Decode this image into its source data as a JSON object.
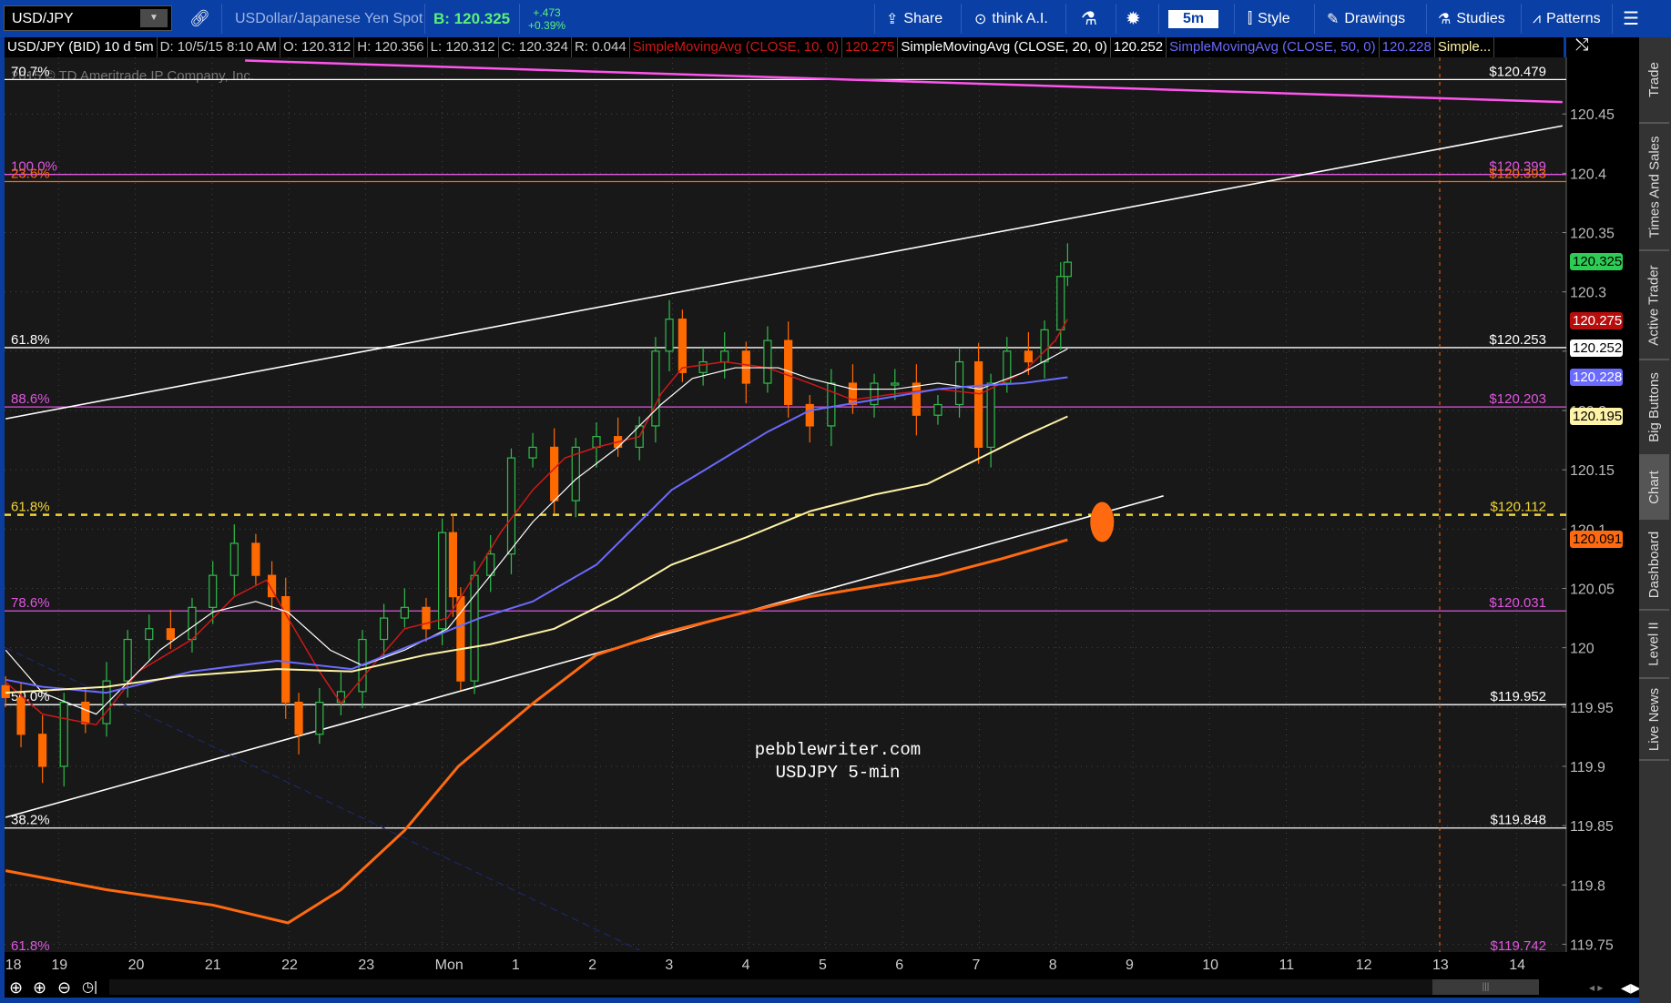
{
  "toolbar": {
    "symbol": "USD/JPY",
    "description": "USDollar/Japanese Yen Spot",
    "bid": "B: 120.325",
    "change_abs": "+.473",
    "change_pct": "+0.39%",
    "share": "Share",
    "think_ai": "think A.I.",
    "timeframe": "5m",
    "style": "Style",
    "drawings": "Drawings",
    "studies": "Studies",
    "patterns": "Patterns"
  },
  "infobar": {
    "title": "USD/JPY (BID) 10 d 5m",
    "date": "D: 10/5/15 8:10 AM",
    "open": "O: 120.312",
    "high": "H: 120.356",
    "low": "L: 120.312",
    "close": "C: 120.324",
    "range": "R: 0.044",
    "sma10_label": "SimpleMovingAvg (CLOSE, 10, 0)",
    "sma10_value": "120.275",
    "sma20_label": "SimpleMovingAvg (CLOSE, 20, 0)",
    "sma20_value": "120.252",
    "sma50_label": "SimpleMovingAvg (CLOSE, 50, 0)",
    "sma50_value": "120.228",
    "more_label": "Simple..."
  },
  "copyright": "2015 © TD Ameritrade IP Company, Inc.",
  "watermark": [
    "pebblewriter.com",
    "USDJPY 5-min"
  ],
  "side_tabs": [
    {
      "label": "Trade",
      "active": false
    },
    {
      "label": "Times And Sales",
      "active": false
    },
    {
      "label": "Active Trader",
      "active": false
    },
    {
      "label": "Big Buttons",
      "active": false
    },
    {
      "label": "Chart",
      "active": true
    },
    {
      "label": "Dashboard",
      "active": false
    },
    {
      "label": "Level II",
      "active": false
    },
    {
      "label": "Live News",
      "active": false
    }
  ],
  "chart_data": {
    "type": "candlestick",
    "title": "USD/JPY (BID) 10 d 5m",
    "ylim": [
      119.738,
      120.51
    ],
    "xlim": [
      -1.75,
      18.5
    ],
    "yticks": [
      "120.45",
      "120.4",
      "120.35",
      "120.3",
      "120.25",
      "120.2",
      "120.15",
      "120.1",
      "120.05",
      "120",
      "119.95",
      "119.9",
      "119.85",
      "119.8",
      "119.75"
    ],
    "xticks": [
      {
        "t": -1.6,
        "label": "18"
      },
      {
        "t": -1.0,
        "label": "19"
      },
      {
        "t": 0,
        "label": "20"
      },
      {
        "t": 1,
        "label": "21"
      },
      {
        "t": 2,
        "label": "22"
      },
      {
        "t": 3,
        "label": "23"
      },
      {
        "t": 4,
        "label": "Mon"
      },
      {
        "t": 5,
        "label": "1"
      },
      {
        "t": 6,
        "label": "2"
      },
      {
        "t": 7,
        "label": "3"
      },
      {
        "t": 8,
        "label": "4"
      },
      {
        "t": 9,
        "label": "5"
      },
      {
        "t": 10,
        "label": "6"
      },
      {
        "t": 11,
        "label": "7"
      },
      {
        "t": 12,
        "label": "8"
      },
      {
        "t": 13,
        "label": "9"
      },
      {
        "t": 14,
        "label": "10"
      },
      {
        "t": 15,
        "label": "11"
      },
      {
        "t": 16,
        "label": "12"
      },
      {
        "t": 17,
        "label": "13"
      },
      {
        "t": 18,
        "label": "14"
      }
    ],
    "colors": {
      "up": "#2fbd4a",
      "down": "#ff6a00"
    },
    "closes": [
      [
        -1.69,
        119.958
      ],
      [
        -1.49,
        119.927
      ],
      [
        -1.21,
        119.9
      ],
      [
        -0.93,
        119.954
      ],
      [
        -0.65,
        119.936
      ],
      [
        -0.375,
        119.972
      ],
      [
        -0.1,
        120.007
      ],
      [
        0.18,
        120.016
      ],
      [
        0.46,
        120.007
      ],
      [
        0.74,
        120.034
      ],
      [
        1.01,
        120.061
      ],
      [
        1.29,
        120.088
      ],
      [
        1.57,
        120.061
      ],
      [
        1.78,
        120.043
      ],
      [
        1.96,
        119.954
      ],
      [
        2.13,
        119.927
      ],
      [
        2.4,
        119.954
      ],
      [
        2.68,
        119.963
      ],
      [
        2.96,
        120.007
      ],
      [
        3.24,
        120.025
      ],
      [
        3.51,
        120.034
      ],
      [
        3.79,
        120.016
      ],
      [
        4.0,
        120.097
      ],
      [
        4.14,
        120.043
      ],
      [
        4.24,
        119.972
      ],
      [
        4.42,
        120.061
      ],
      [
        4.63,
        120.079
      ],
      [
        4.9,
        120.16
      ],
      [
        5.18,
        120.169
      ],
      [
        5.46,
        120.124
      ],
      [
        5.74,
        120.169
      ],
      [
        6.01,
        120.178
      ],
      [
        6.29,
        120.169
      ],
      [
        6.57,
        120.187
      ],
      [
        6.78,
        120.25
      ],
      [
        6.96,
        120.277
      ],
      [
        7.13,
        120.232
      ],
      [
        7.4,
        120.241
      ],
      [
        7.68,
        120.25
      ],
      [
        7.96,
        120.223
      ],
      [
        8.24,
        120.259
      ],
      [
        8.51,
        120.205
      ],
      [
        8.79,
        120.187
      ],
      [
        9.07,
        120.223
      ],
      [
        9.35,
        120.205
      ],
      [
        9.63,
        120.223
      ],
      [
        9.9,
        120.223
      ],
      [
        10.18,
        120.196
      ],
      [
        10.46,
        120.205
      ],
      [
        10.74,
        120.241
      ],
      [
        10.99,
        120.169
      ],
      [
        11.15,
        120.223
      ],
      [
        11.36,
        120.25
      ],
      [
        11.64,
        120.241
      ],
      [
        11.85,
        120.268
      ],
      [
        12.06,
        120.313
      ],
      [
        12.15,
        120.325
      ]
    ],
    "series": [
      {
        "name": "SMA 10",
        "color": "#d01818",
        "width": 1.5,
        "points": [
          [
            -1.69,
            119.971
          ],
          [
            -1.21,
            119.944
          ],
          [
            -0.51,
            119.935
          ],
          [
            0.04,
            119.98
          ],
          [
            0.74,
            120.007
          ],
          [
            1.29,
            120.043
          ],
          [
            1.71,
            120.057
          ],
          [
            1.99,
            120.025
          ],
          [
            2.4,
            119.98
          ],
          [
            2.68,
            119.953
          ],
          [
            3.03,
            119.98
          ],
          [
            3.51,
            120.016
          ],
          [
            4.07,
            120.025
          ],
          [
            4.42,
            120.061
          ],
          [
            4.76,
            120.097
          ],
          [
            5.18,
            120.133
          ],
          [
            5.6,
            120.16
          ],
          [
            6.01,
            120.169
          ],
          [
            6.57,
            120.178
          ],
          [
            6.85,
            120.214
          ],
          [
            7.13,
            120.236
          ],
          [
            7.68,
            120.241
          ],
          [
            8.24,
            120.236
          ],
          [
            8.79,
            120.223
          ],
          [
            9.35,
            120.209
          ],
          [
            9.9,
            120.214
          ],
          [
            10.46,
            120.218
          ],
          [
            11.01,
            120.214
          ],
          [
            11.57,
            120.232
          ],
          [
            11.99,
            120.259
          ],
          [
            12.15,
            120.277
          ]
        ]
      },
      {
        "name": "SMA 20",
        "color": "#ffffff",
        "width": 1.2,
        "points": [
          [
            -1.69,
            119.998
          ],
          [
            -1.21,
            119.962
          ],
          [
            -0.51,
            119.944
          ],
          [
            0.32,
            119.998
          ],
          [
            1.01,
            120.03
          ],
          [
            1.57,
            120.039
          ],
          [
            1.99,
            120.03
          ],
          [
            2.54,
            119.998
          ],
          [
            2.96,
            119.985
          ],
          [
            3.51,
            119.998
          ],
          [
            4.07,
            120.016
          ],
          [
            4.63,
            120.061
          ],
          [
            5.18,
            120.106
          ],
          [
            5.74,
            120.142
          ],
          [
            6.29,
            120.169
          ],
          [
            6.85,
            120.205
          ],
          [
            7.26,
            120.227
          ],
          [
            7.82,
            120.236
          ],
          [
            8.38,
            120.236
          ],
          [
            8.79,
            120.227
          ],
          [
            9.35,
            120.218
          ],
          [
            9.9,
            120.218
          ],
          [
            10.46,
            120.223
          ],
          [
            11.01,
            120.218
          ],
          [
            11.57,
            120.232
          ],
          [
            12.15,
            120.252
          ]
        ]
      },
      {
        "name": "SMA 50",
        "color": "#6a6aff",
        "width": 2,
        "points": [
          [
            -1.69,
            119.973
          ],
          [
            -1.21,
            119.967
          ],
          [
            -0.38,
            119.962
          ],
          [
            0.74,
            119.98
          ],
          [
            1.85,
            119.989
          ],
          [
            2.82,
            119.982
          ],
          [
            3.79,
            120.007
          ],
          [
            4.49,
            120.025
          ],
          [
            5.18,
            120.039
          ],
          [
            6.01,
            120.07
          ],
          [
            6.57,
            120.106
          ],
          [
            6.99,
            120.133
          ],
          [
            7.68,
            120.16
          ],
          [
            8.24,
            120.182
          ],
          [
            8.79,
            120.2
          ],
          [
            9.63,
            120.209
          ],
          [
            10.46,
            120.218
          ],
          [
            11.01,
            120.221
          ],
          [
            11.57,
            120.223
          ],
          [
            12.15,
            120.228
          ]
        ]
      },
      {
        "name": "SMA yellow",
        "color": "#fff3a8",
        "width": 2,
        "points": [
          [
            -1.69,
            119.962
          ],
          [
            -0.38,
            119.967
          ],
          [
            0.6,
            119.976
          ],
          [
            1.85,
            119.982
          ],
          [
            2.82,
            119.98
          ],
          [
            3.79,
            119.994
          ],
          [
            4.63,
            120.003
          ],
          [
            5.46,
            120.016
          ],
          [
            6.29,
            120.043
          ],
          [
            6.99,
            120.07
          ],
          [
            7.96,
            120.093
          ],
          [
            8.79,
            120.115
          ],
          [
            9.63,
            120.129
          ],
          [
            10.32,
            120.138
          ],
          [
            11.01,
            120.16
          ],
          [
            11.57,
            120.178
          ],
          [
            12.15,
            120.195
          ]
        ]
      },
      {
        "name": "SMA orange",
        "color": "#ff6a10",
        "width": 3,
        "points": [
          [
            -1.69,
            119.812
          ],
          [
            -0.38,
            119.796
          ],
          [
            1.01,
            119.783
          ],
          [
            1.99,
            119.768
          ],
          [
            2.68,
            119.796
          ],
          [
            3.51,
            119.846
          ],
          [
            4.21,
            119.9
          ],
          [
            5.18,
            119.953
          ],
          [
            6.01,
            119.994
          ],
          [
            6.85,
            120.012
          ],
          [
            7.96,
            120.03
          ],
          [
            8.79,
            120.043
          ],
          [
            9.63,
            120.052
          ],
          [
            10.46,
            120.061
          ],
          [
            11.29,
            120.075
          ],
          [
            12.15,
            120.091
          ]
        ]
      }
    ],
    "trendlines": [
      {
        "name": "magenta-trendline",
        "color": "#ff55ee",
        "width": 2.5,
        "from": [
          1.43,
          120.495
        ],
        "to": [
          18.6,
          120.46
        ]
      },
      {
        "name": "upper-channel-line",
        "color": "#ffffff",
        "width": 1.6,
        "from": [
          -1.69,
          120.193
        ],
        "to": [
          18.6,
          120.44
        ]
      },
      {
        "name": "lower-channel-line",
        "color": "#ffffff",
        "width": 1.6,
        "from": [
          -1.69,
          119.857
        ],
        "to": [
          13.4,
          120.128
        ]
      },
      {
        "name": "navy-dashed-line",
        "color": "#1c2a7a",
        "width": 1,
        "dash": true,
        "from": [
          -1.69,
          120.0
        ],
        "to": [
          6.57,
          119.745
        ]
      }
    ],
    "fib_levels": [
      {
        "pct": "70.7%",
        "price": 120.479,
        "label": "$120.479",
        "color": "#ffffff",
        "line": true
      },
      {
        "pct": "100.0%",
        "price": 120.399,
        "label": "$120.399",
        "color": "#e055e0",
        "line": true
      },
      {
        "pct": "23.6%",
        "price": 120.393,
        "label": "$120.393",
        "color": "#ff6a10",
        "line": true
      },
      {
        "pct": "61.8%",
        "price": 120.253,
        "label": "$120.253",
        "color": "#ffffff",
        "line": true
      },
      {
        "pct": "88.6%",
        "price": 120.203,
        "label": "$120.203",
        "color": "#e055e0",
        "line": true
      },
      {
        "pct": "61.8%",
        "price": 120.112,
        "label": "$120.112",
        "color": "#f2d633",
        "line": true,
        "dashed": true
      },
      {
        "pct": "78.6%",
        "price": 120.031,
        "label": "$120.031",
        "color": "#e055e0",
        "line": true
      },
      {
        "pct": "50.0%",
        "price": 119.952,
        "label": "$119.952",
        "color": "#ffffff",
        "line": true
      },
      {
        "pct": "38.2%",
        "price": 119.848,
        "label": "$119.848",
        "color": "#ffffff",
        "line": true
      },
      {
        "pct": "61.8%",
        "price": 119.742,
        "label": "$119.742",
        "color": "#e055e0",
        "line": false
      }
    ],
    "marker": {
      "t": 12.6,
      "price": 120.106,
      "color": "#ff6a10"
    },
    "vertical_line": {
      "t": 17.0,
      "color": "#ff6a10"
    },
    "badges": [
      {
        "label": "120.325",
        "price": 120.325,
        "bg": "#2ecc55",
        "fg": "#000"
      },
      {
        "label": "120.275",
        "price": 120.275,
        "bg": "#b80d0d",
        "fg": "#fff"
      },
      {
        "label": "120.252",
        "price": 120.252,
        "bg": "#ffffff",
        "fg": "#000"
      },
      {
        "label": "120.228",
        "price": 120.228,
        "bg": "#6a6aff",
        "fg": "#fff"
      },
      {
        "label": "120.195",
        "price": 120.195,
        "bg": "#fff3a8",
        "fg": "#000"
      },
      {
        "label": "120.091",
        "price": 120.091,
        "bg": "#ff6a10",
        "fg": "#000"
      }
    ]
  }
}
